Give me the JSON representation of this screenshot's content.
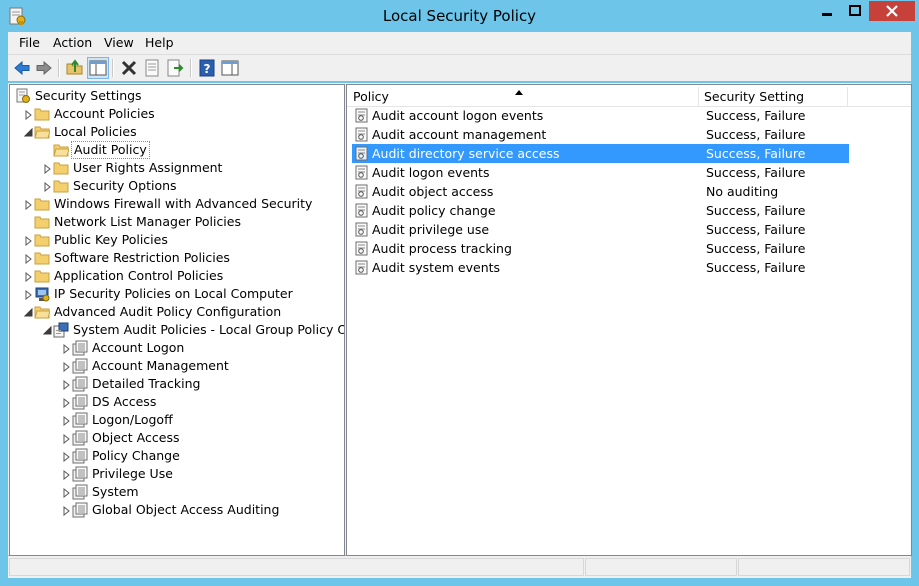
{
  "window": {
    "title": "Local Security Policy",
    "icons": {
      "app": "security-policy-icon",
      "minimize": "minimize-icon",
      "maximize": "maximize-icon",
      "close": "close-icon"
    },
    "colors": {
      "frame": "#6dc6ea",
      "close_button": "#c7413b",
      "selection": "#3399ff"
    }
  },
  "menu": [
    "File",
    "Action",
    "View",
    "Help"
  ],
  "toolbar": [
    "back-icon",
    "forward-icon",
    "up-folder-icon",
    "show-hide-console-tree-icon",
    "delete-icon",
    "properties-icon",
    "export-list-icon",
    "help-icon",
    "show-hide-action-pane-icon"
  ],
  "tree": [
    {
      "label": "Security Settings",
      "level": 0,
      "expander": "none",
      "icon": "security-settings-icon"
    },
    {
      "label": "Account Policies",
      "level": 1,
      "expander": "collapsed",
      "icon": "folder-icon"
    },
    {
      "label": "Local Policies",
      "level": 1,
      "expander": "expanded",
      "icon": "folder-icon"
    },
    {
      "label": "Audit Policy",
      "level": 2,
      "expander": "none",
      "icon": "folder-icon",
      "selected": true
    },
    {
      "label": "User Rights Assignment",
      "level": 2,
      "expander": "collapsed",
      "icon": "folder-icon"
    },
    {
      "label": "Security Options",
      "level": 2,
      "expander": "collapsed",
      "icon": "folder-icon"
    },
    {
      "label": "Windows Firewall with Advanced Security",
      "level": 1,
      "expander": "collapsed",
      "icon": "folder-icon"
    },
    {
      "label": "Network List Manager Policies",
      "level": 1,
      "expander": "none",
      "icon": "folder-icon"
    },
    {
      "label": "Public Key Policies",
      "level": 1,
      "expander": "collapsed",
      "icon": "folder-icon"
    },
    {
      "label": "Software Restriction Policies",
      "level": 1,
      "expander": "collapsed",
      "icon": "folder-icon"
    },
    {
      "label": "Application Control Policies",
      "level": 1,
      "expander": "collapsed",
      "icon": "folder-icon"
    },
    {
      "label": "IP Security Policies on Local Computer",
      "level": 1,
      "expander": "collapsed",
      "icon": "ip-security-icon"
    },
    {
      "label": "Advanced Audit Policy Configuration",
      "level": 1,
      "expander": "expanded",
      "icon": "folder-icon"
    },
    {
      "label": "System Audit Policies - Local Group Policy Object",
      "level": 2,
      "expander": "expanded",
      "icon": "group-policy-object-icon"
    },
    {
      "label": "Account Logon",
      "level": 3,
      "expander": "collapsed",
      "icon": "audit-category-icon"
    },
    {
      "label": "Account Management",
      "level": 3,
      "expander": "collapsed",
      "icon": "audit-category-icon"
    },
    {
      "label": "Detailed Tracking",
      "level": 3,
      "expander": "collapsed",
      "icon": "audit-category-icon"
    },
    {
      "label": "DS Access",
      "level": 3,
      "expander": "collapsed",
      "icon": "audit-category-icon"
    },
    {
      "label": "Logon/Logoff",
      "level": 3,
      "expander": "collapsed",
      "icon": "audit-category-icon"
    },
    {
      "label": "Object Access",
      "level": 3,
      "expander": "collapsed",
      "icon": "audit-category-icon"
    },
    {
      "label": "Policy Change",
      "level": 3,
      "expander": "collapsed",
      "icon": "audit-category-icon"
    },
    {
      "label": "Privilege Use",
      "level": 3,
      "expander": "collapsed",
      "icon": "audit-category-icon"
    },
    {
      "label": "System",
      "level": 3,
      "expander": "collapsed",
      "icon": "audit-category-icon"
    },
    {
      "label": "Global Object Access Auditing",
      "level": 3,
      "expander": "collapsed",
      "icon": "audit-category-icon"
    }
  ],
  "list": {
    "columns": [
      "Policy",
      "Security Setting"
    ],
    "sorted_column": "Policy",
    "rows": [
      {
        "policy": "Audit account logon events",
        "setting": "Success, Failure"
      },
      {
        "policy": "Audit account management",
        "setting": "Success, Failure"
      },
      {
        "policy": "Audit directory service access",
        "setting": "Success, Failure",
        "selected": true
      },
      {
        "policy": "Audit logon events",
        "setting": "Success, Failure"
      },
      {
        "policy": "Audit object access",
        "setting": "No auditing"
      },
      {
        "policy": "Audit policy change",
        "setting": "Success, Failure"
      },
      {
        "policy": "Audit privilege use",
        "setting": "Success, Failure"
      },
      {
        "policy": "Audit process tracking",
        "setting": "Success, Failure"
      },
      {
        "policy": "Audit system events",
        "setting": "Success, Failure"
      }
    ]
  }
}
